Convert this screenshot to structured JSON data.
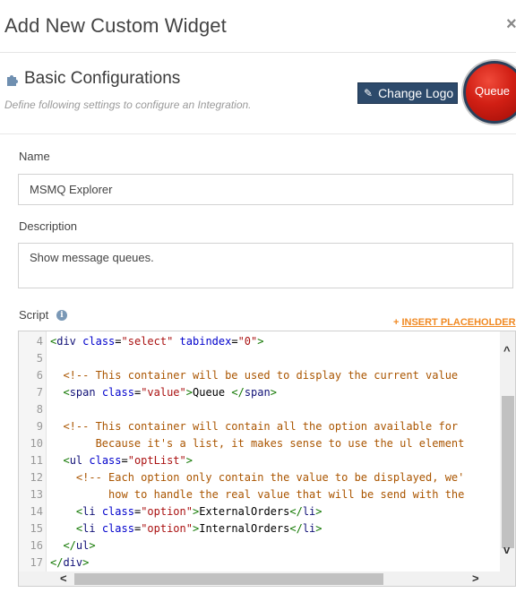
{
  "modal": {
    "title": "Add New Custom Widget",
    "close_glyph": "×"
  },
  "section": {
    "icon": "puzzle-piece-icon",
    "title": "Basic Configurations",
    "subtitle": "Define following settings to configure an Integration.",
    "change_logo_label": "Change Logo",
    "logo_text": "Queue",
    "logo_color": "#d11f14"
  },
  "fields": {
    "name_label": "Name",
    "name_value": "MSMQ Explorer",
    "description_label": "Description",
    "description_value": "Show message queues.",
    "script_label": "Script",
    "insert_placeholder_label": "INSERT PLACEHOLDER"
  },
  "editor": {
    "lines": [
      {
        "n": "4",
        "segments": [
          [
            "tag",
            "<"
          ],
          [
            "tagname",
            "div"
          ],
          [
            "txt",
            " "
          ],
          [
            "attr",
            "class"
          ],
          [
            "txt",
            "="
          ],
          [
            "str",
            "\"select\""
          ],
          [
            "txt",
            " "
          ],
          [
            "attr",
            "tabindex"
          ],
          [
            "txt",
            "="
          ],
          [
            "str",
            "\"0\""
          ],
          [
            "tag",
            ">"
          ]
        ]
      },
      {
        "n": "5",
        "segments": []
      },
      {
        "n": "6",
        "segments": [
          [
            "txt",
            "  "
          ],
          [
            "cmt",
            "<!-- This container will be used to display the current value"
          ]
        ]
      },
      {
        "n": "7",
        "segments": [
          [
            "txt",
            "  "
          ],
          [
            "tag",
            "<"
          ],
          [
            "tagname",
            "span"
          ],
          [
            "txt",
            " "
          ],
          [
            "attr",
            "class"
          ],
          [
            "txt",
            "="
          ],
          [
            "str",
            "\"value\""
          ],
          [
            "tag",
            ">"
          ],
          [
            "txt",
            "Queue "
          ],
          [
            "tag",
            "</"
          ],
          [
            "tagname",
            "span"
          ],
          [
            "tag",
            ">"
          ]
        ]
      },
      {
        "n": "8",
        "segments": []
      },
      {
        "n": "9",
        "segments": [
          [
            "txt",
            "  "
          ],
          [
            "cmt",
            "<!-- This container will contain all the option available for"
          ]
        ]
      },
      {
        "n": "10",
        "segments": [
          [
            "txt",
            "       "
          ],
          [
            "cmt",
            "Because it's a list, it makes sense to use the ul element"
          ]
        ]
      },
      {
        "n": "11",
        "segments": [
          [
            "txt",
            "  "
          ],
          [
            "tag",
            "<"
          ],
          [
            "tagname",
            "ul"
          ],
          [
            "txt",
            " "
          ],
          [
            "attr",
            "class"
          ],
          [
            "txt",
            "="
          ],
          [
            "str",
            "\"optList\""
          ],
          [
            "tag",
            ">"
          ]
        ]
      },
      {
        "n": "12",
        "segments": [
          [
            "txt",
            "    "
          ],
          [
            "cmt",
            "<!-- Each option only contain the value to be displayed, we'"
          ]
        ]
      },
      {
        "n": "13",
        "segments": [
          [
            "txt",
            "         "
          ],
          [
            "cmt",
            "how to handle the real value that will be send with the"
          ]
        ]
      },
      {
        "n": "14",
        "segments": [
          [
            "txt",
            "    "
          ],
          [
            "tag",
            "<"
          ],
          [
            "tagname",
            "li"
          ],
          [
            "txt",
            " "
          ],
          [
            "attr",
            "class"
          ],
          [
            "txt",
            "="
          ],
          [
            "str",
            "\"option\""
          ],
          [
            "tag",
            ">"
          ],
          [
            "txt",
            "ExternalOrders"
          ],
          [
            "tag",
            "</"
          ],
          [
            "tagname",
            "li"
          ],
          [
            "tag",
            ">"
          ]
        ]
      },
      {
        "n": "15",
        "segments": [
          [
            "txt",
            "    "
          ],
          [
            "tag",
            "<"
          ],
          [
            "tagname",
            "li"
          ],
          [
            "txt",
            " "
          ],
          [
            "attr",
            "class"
          ],
          [
            "txt",
            "="
          ],
          [
            "str",
            "\"option\""
          ],
          [
            "tag",
            ">"
          ],
          [
            "txt",
            "InternalOrders"
          ],
          [
            "tag",
            "</"
          ],
          [
            "tagname",
            "li"
          ],
          [
            "tag",
            ">"
          ]
        ]
      },
      {
        "n": "16",
        "segments": [
          [
            "txt",
            "  "
          ],
          [
            "tag",
            "</"
          ],
          [
            "tagname",
            "ul"
          ],
          [
            "tag",
            ">"
          ]
        ]
      },
      {
        "n": "17",
        "segments": [
          [
            "tag",
            "</"
          ],
          [
            "tagname",
            "div"
          ],
          [
            "tag",
            ">"
          ]
        ]
      }
    ],
    "scroll_up_glyph": "^",
    "scroll_down_glyph": "v",
    "scroll_left_glyph": "<",
    "scroll_right_glyph": ">"
  }
}
